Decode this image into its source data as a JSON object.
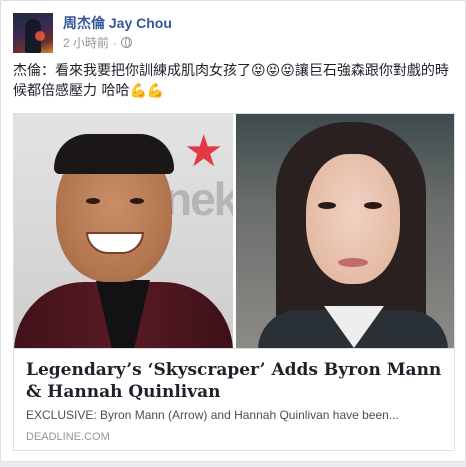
{
  "post": {
    "author": "周杰倫 Jay Chou",
    "time": "2 小時前",
    "separator": "·",
    "text_part1": "杰倫：看來我要把你訓練成肌肉女孩了",
    "text_part2": "讓巨石強森跟你對戲的時候都倍感壓力 哈哈",
    "emoji_tongue": "😝",
    "emoji_muscle": "💪"
  },
  "link": {
    "title": "Legendary’s ‘Skyscraper’ Adds Byron Mann & Hannah Quinlivan",
    "description": "EXCLUSIVE: Byron Mann (Arrow) and Hannah Quinlivan have been...",
    "domain": "DEADLINE.COM",
    "background_brand_text": "nek"
  },
  "colors": {
    "author": "#365899",
    "meta": "#90949c"
  }
}
